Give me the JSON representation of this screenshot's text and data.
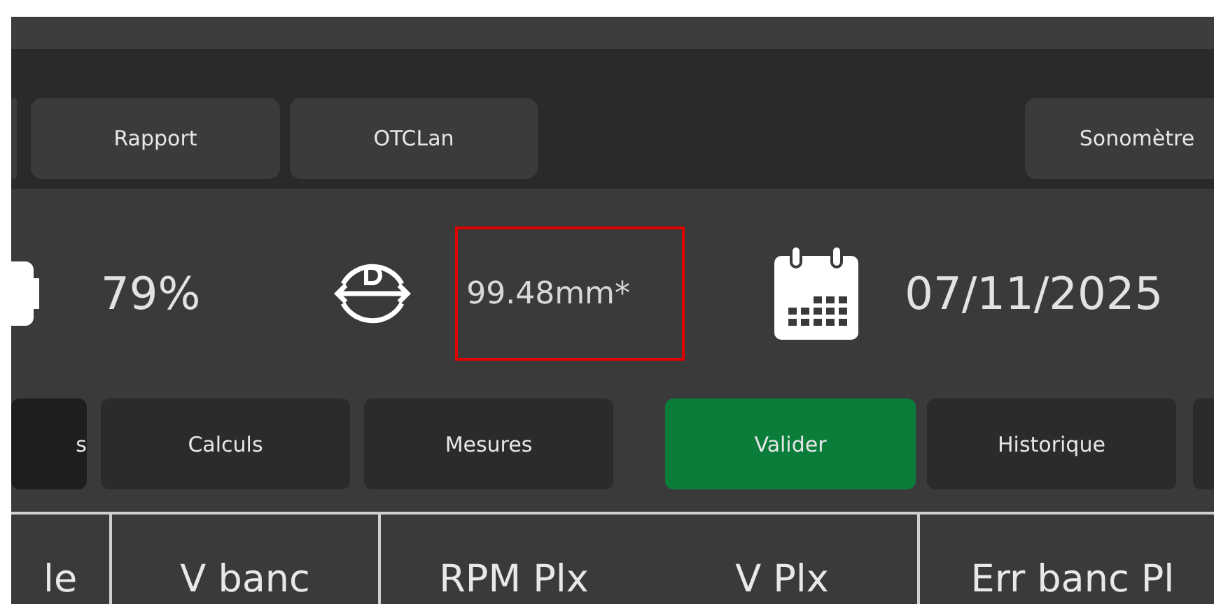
{
  "top_tabs": [
    {
      "selected": false
    },
    {
      "label": "Rapport",
      "selected": false
    },
    {
      "label": "OTCLan",
      "selected": false
    },
    {
      "label": "Sonomètre",
      "selected": false
    }
  ],
  "status": {
    "battery": "79%",
    "diameter": "99.48mm*",
    "date": "07/11/2025"
  },
  "actions": [
    {
      "label": "s",
      "kind": "nav",
      "selected": true
    },
    {
      "label": "Calculs",
      "kind": "nav",
      "selected": false
    },
    {
      "label": "Mesures",
      "kind": "nav",
      "selected": false
    },
    {
      "label": "Valider",
      "kind": "confirm",
      "selected": false
    },
    {
      "label": "Historique",
      "kind": "nav",
      "selected": false
    },
    {
      "kind": "nav",
      "selected": false
    }
  ],
  "table": {
    "columns": [
      "le",
      "V banc",
      "RPM Plx",
      "V Plx",
      "Err banc Pl"
    ]
  }
}
